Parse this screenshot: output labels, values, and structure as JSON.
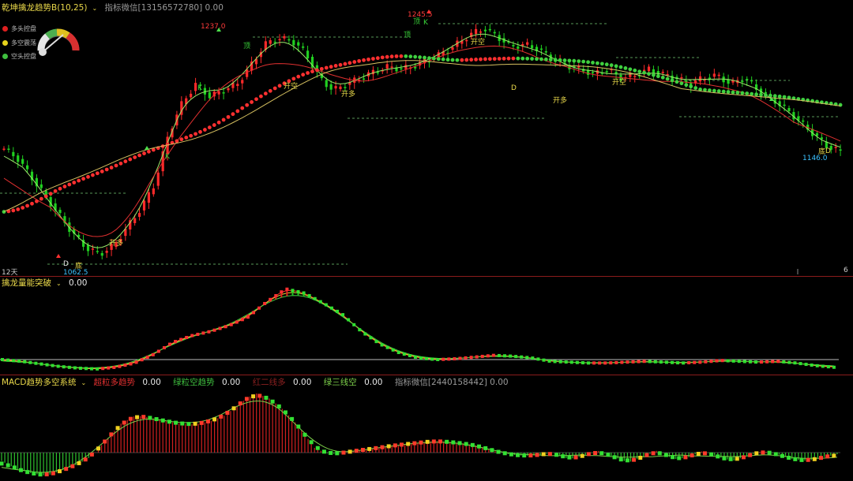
{
  "main": {
    "title": "乾坤擒龙趋势B(10,25)",
    "title_chevron": "⌄",
    "subtitle": "指标微信[13156572780] 0.00",
    "legend": [
      {
        "label": "多头控盘",
        "color": "#e02020"
      },
      {
        "label": "多空震荡",
        "color": "#e6d21c"
      },
      {
        "label": "空头控盘",
        "color": "#3fbf3f"
      }
    ],
    "price_labels": {
      "high1": "1237.0",
      "high2": "1245.5",
      "low1": "1062.5",
      "low2": "1146.0"
    },
    "signal_labels": {
      "k": "K",
      "ding": "顶",
      "di": "底",
      "d": "D",
      "kaikong": "开空",
      "kaiduo": "开多"
    },
    "axis_left": "12天",
    "axis_right": "6"
  },
  "osc": {
    "title": "擒龙量能突破",
    "title_chevron": "⌄",
    "value": "0.00"
  },
  "macd": {
    "title": "MACD趋势多空系统",
    "title_chevron": "⌄",
    "items": [
      {
        "label": "超粒多趋势",
        "value": "0.00",
        "color": "#e03030"
      },
      {
        "label": "绿粒空趋势",
        "value": "0.00",
        "color": "#3fbf3f"
      },
      {
        "label": "红二线多",
        "value": "0.00",
        "color": "#8b2020"
      },
      {
        "label": "绿三线空",
        "value": "0.00",
        "color": "#7ccf4a"
      }
    ],
    "suffix": "指标微信[2440158442] 0.00"
  },
  "chart_data": [
    {
      "type": "line",
      "series": [
        {
          "values": [
            1148,
            1140,
            1125,
            1110,
            1095,
            1080,
            1068,
            1063,
            1070,
            1085,
            1100,
            1120,
            1160,
            1185,
            1200,
            1190,
            1195,
            1200,
            1215,
            1232,
            1237,
            1235,
            1225,
            1205,
            1195,
            1200,
            1205,
            1210,
            1214,
            1212,
            1215,
            1220,
            1225,
            1232,
            1240,
            1245,
            1238,
            1230,
            1232,
            1228,
            1220,
            1215,
            1212,
            1208,
            1212,
            1205,
            1207,
            1212,
            1208,
            1205,
            1200,
            1205,
            1207,
            1200,
            1205,
            1195,
            1188,
            1180,
            1170,
            1160,
            1150,
            1146
          ]
        }
      ]
    },
    {
      "type": "line",
      "series": [
        {
          "values": [
            0.12,
            0.1,
            0.07,
            0.04,
            0.02,
            0.01,
            0.03,
            0.08,
            0.18,
            0.32,
            0.4,
            0.45,
            0.52,
            0.62,
            0.8,
            0.95,
            0.9,
            0.78,
            0.65,
            0.45,
            0.3,
            0.2,
            0.14,
            0.12,
            0.13,
            0.15,
            0.17,
            0.16,
            0.14,
            0.1,
            0.09,
            0.08,
            0.08,
            0.09,
            0.1,
            0.09,
            0.08,
            0.09,
            0.11,
            0.1,
            0.09,
            0.1,
            0.08,
            0.05,
            0.03
          ]
        }
      ]
    },
    {
      "type": "bar",
      "series": [
        {
          "values": [
            -0.1,
            -0.2,
            -0.25,
            -0.28,
            -0.22,
            -0.15,
            -0.05,
            0.15,
            0.35,
            0.45,
            0.42,
            0.38,
            0.35,
            0.34,
            0.38,
            0.45,
            0.6,
            0.72,
            0.65,
            0.5,
            0.3,
            0.05,
            -0.02,
            0.0,
            0.03,
            0.05,
            0.08,
            0.1,
            0.12,
            0.14,
            0.13,
            0.11,
            0.08,
            0.02,
            -0.02,
            -0.04,
            -0.03,
            0.0,
            -0.08,
            -0.04,
            0.02,
            -0.05,
            -0.12,
            -0.05,
            0.03,
            -0.08,
            -0.06,
            0.02,
            -0.05,
            -0.1,
            -0.04,
            0.02,
            -0.02,
            -0.08,
            -0.1,
            -0.06,
            -0.02
          ]
        }
      ]
    }
  ]
}
